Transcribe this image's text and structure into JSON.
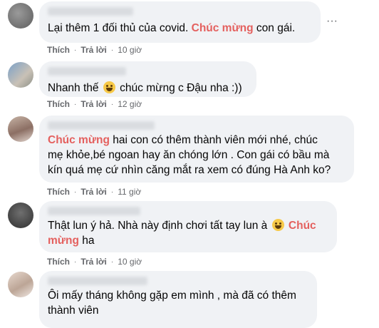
{
  "actions": {
    "like": "Thích",
    "reply": "Trả lời",
    "dot": "·"
  },
  "more_icon": "more-horizontal-icon",
  "comments": [
    {
      "time": "10 giờ",
      "text_before": "Lại thêm 1 đối thủ của covid. ",
      "highlight": "Chúc mừng",
      "text_after": " con gái."
    },
    {
      "time": "12 giờ",
      "text_before": "Nhanh thế ",
      "emoji": "laughing-emoji",
      "text_after": " chúc mừng c Đậu nha :))"
    },
    {
      "time": "11 giờ",
      "highlight": "Chúc mừng",
      "text_after": " hai con có thêm thành viên mới nhé, chúc",
      "line2": "mẹ khỏe,bé ngoan hay ăn chóng lớn . Con gái có bầu mà",
      "line3": "kín quá mẹ cứ nhìn căng mắt ra xem có đúng Hà Anh ko?"
    },
    {
      "time": "10 giờ",
      "text_before": "Thật lun ý hả. Nhà này định chơi tất tay lun à ",
      "emoji": "grinning-emoji",
      "highlight": "Chúc",
      "line2_highlight": "mừng",
      "line2_after": " ha"
    },
    {
      "line1": "Ôi mấy tháng không gặp em mình , mà đã có thêm",
      "line2": "thành viên"
    }
  ]
}
